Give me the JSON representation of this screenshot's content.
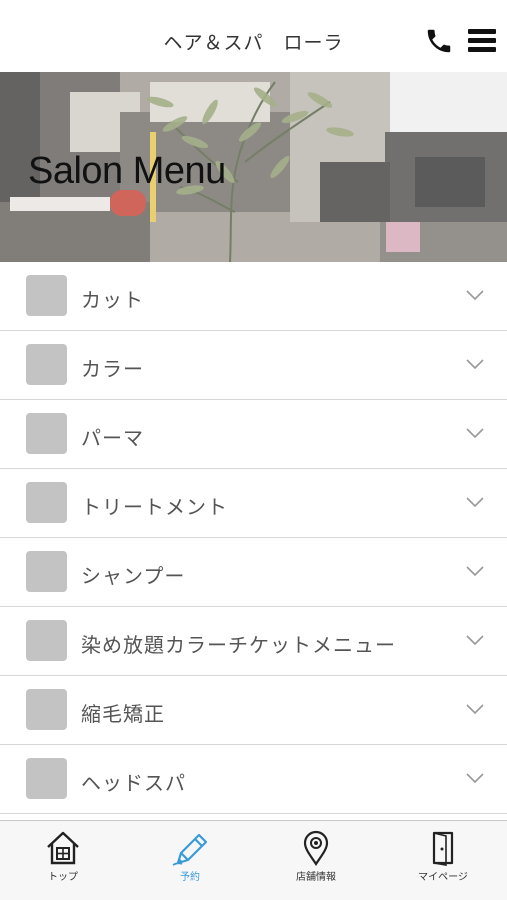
{
  "header": {
    "title": "ヘア＆スパ　ローラ",
    "phone_icon": "phone-icon",
    "menu_icon": "hamburger-menu-icon"
  },
  "hero": {
    "title": "Salon Menu"
  },
  "menu": {
    "items": [
      {
        "label": "カット"
      },
      {
        "label": "カラー"
      },
      {
        "label": "パーマ"
      },
      {
        "label": "トリートメント"
      },
      {
        "label": "シャンプー"
      },
      {
        "label": "染め放題カラーチケットメニュー"
      },
      {
        "label": "縮毛矯正"
      },
      {
        "label": "ヘッドスパ"
      }
    ]
  },
  "tabbar": {
    "tabs": [
      {
        "label": "トップ",
        "icon": "home-icon",
        "active": false
      },
      {
        "label": "予約",
        "icon": "pencil-icon",
        "active": true
      },
      {
        "label": "店舗情報",
        "icon": "map-pin-icon",
        "active": false
      },
      {
        "label": "マイページ",
        "icon": "door-icon",
        "active": false
      }
    ],
    "active_color": "#3b9bd9"
  }
}
